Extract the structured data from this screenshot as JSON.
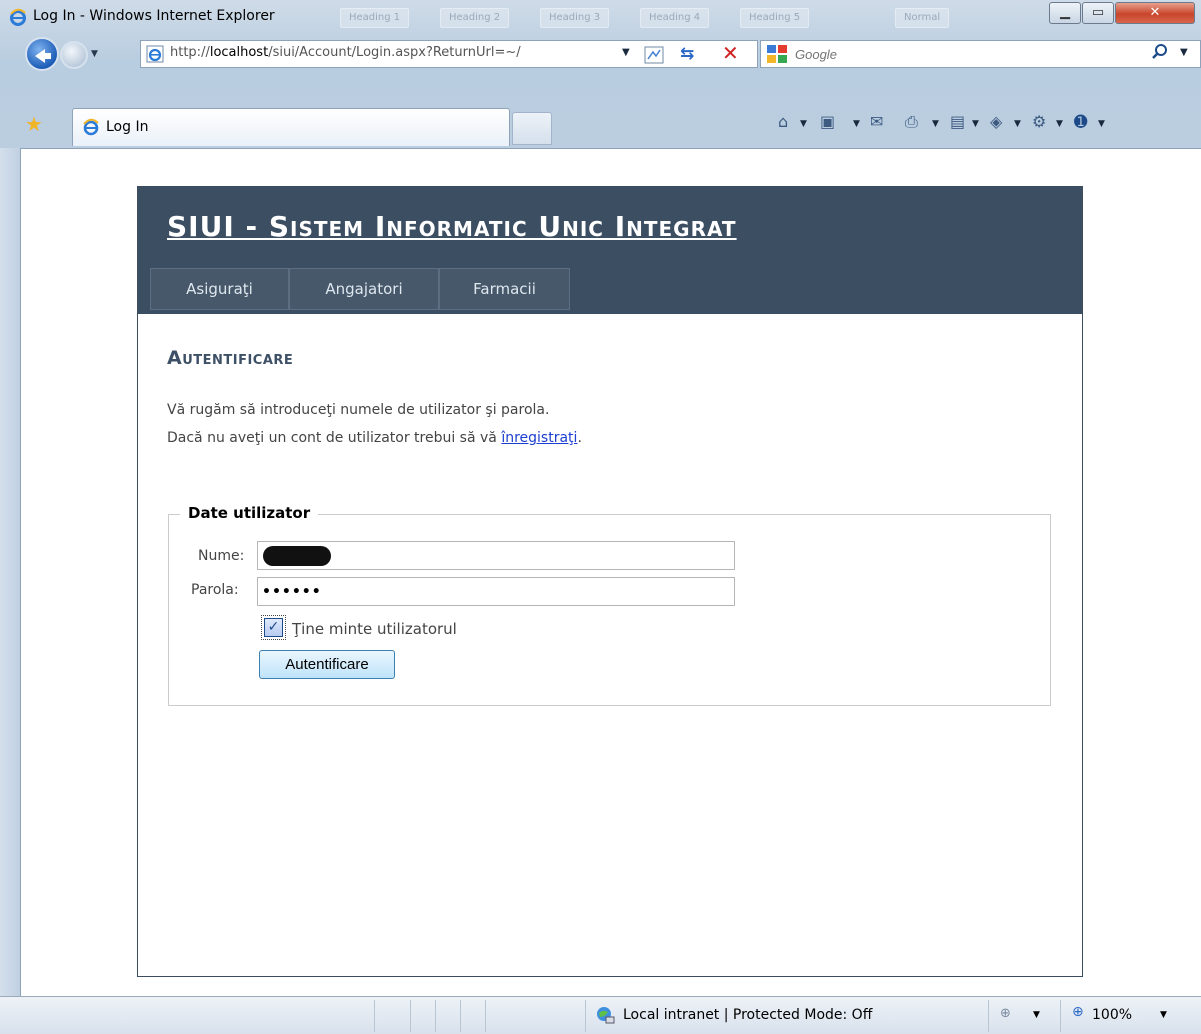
{
  "window": {
    "title": "Log In - Windows Internet Explorer",
    "ghost_tabs": [
      "Heading 1",
      "Heading 2",
      "Heading 3",
      "Heading 4",
      "Heading 5",
      "Normal"
    ]
  },
  "address_bar": {
    "url_prefix": "http://",
    "url_host": "localhost",
    "url_rest": "/siui/Account/Login.aspx?ReturnUrl=~/"
  },
  "search": {
    "placeholder": "Google"
  },
  "tabs": [
    {
      "label": "Log In"
    }
  ],
  "site": {
    "title": "SIUI - Sistem Informatic Unic Integrat",
    "menu": [
      "Asiguraţi",
      "Angajatori",
      "Farmacii"
    ]
  },
  "main": {
    "heading": "Autentificare",
    "line1": "Vă rugăm să introduceţi numele de utilizator şi parola.",
    "line2_before": "Dacă nu aveţi un cont de utilizator trebui să vă ",
    "line2_link": "înregistraţi",
    "line2_after": "."
  },
  "form": {
    "legend": "Date utilizator",
    "username_label": "Nume:",
    "password_label": "Parola:",
    "password_value": "••••••",
    "remember_label": "Ţine minte utilizatorul",
    "remember_checked": true,
    "submit_label": "Autentificare"
  },
  "status_bar": {
    "zone": "Local intranet | Protected Mode: Off",
    "zoom": "100%"
  },
  "icons": {
    "back": "back-icon",
    "forward": "forward-icon",
    "refresh": "refresh-icon",
    "stop": "stop-icon",
    "home": "home-icon",
    "feeds": "feeds-icon",
    "mail": "mail-icon",
    "print": "print-icon",
    "page": "page-icon",
    "safety": "safety-icon",
    "tools": "tools-icon",
    "help": "help-icon"
  },
  "colors": {
    "header_bg": "#3c4e61",
    "menu_bg": "#465869",
    "heading": "#3d5066",
    "link": "#1c3fd1"
  }
}
